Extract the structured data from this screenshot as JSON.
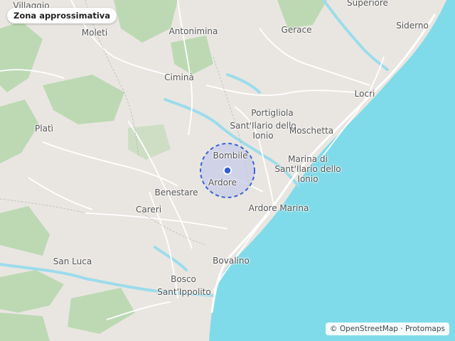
{
  "badge": {
    "label": "Zona approssimativa"
  },
  "attribution": {
    "text": "© OpenStreetMap · Protomaps"
  },
  "colors": {
    "land": "#e9e6e1",
    "sea": "#7fdbe9",
    "forest": "#b8d8b0",
    "road": "#ffffff",
    "area_fill": "#c9cde8",
    "area_stroke": "#3b62d6",
    "marker": "#2f5ed8"
  },
  "places": {
    "villaggio": "Villaggio",
    "moleti": "Moleti",
    "antonimina": "Antonimina",
    "gerace": "Gerace",
    "superiore": "Superiore",
    "siderno": "Siderno",
    "cimina": "Ciminà",
    "locri": "Locri",
    "plati": "Platì",
    "portigliola": "Portigliola",
    "santilario_line1": "Sant'Ilario dello",
    "santilario_line2": "Ionio",
    "moschetta": "Moschetta",
    "bombile": "Bombile",
    "marina_line1": "Marina di",
    "marina_line2": "Sant'Ilario dello",
    "marina_line3": "Ionio",
    "ardore": "Ardore",
    "benestare": "Benestare",
    "careri": "Careri",
    "ardore_marina": "Ardore Marina",
    "san_luca": "San Luca",
    "bovalino": "Bovalino",
    "bosco": "Bosco",
    "santippolito": "Sant'Ippolito"
  }
}
